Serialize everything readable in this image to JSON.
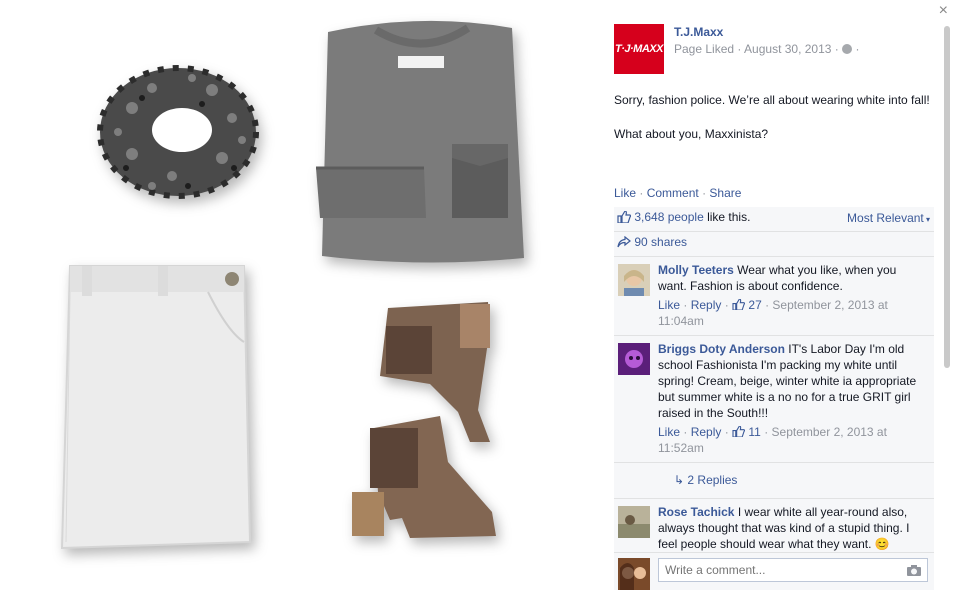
{
  "post": {
    "page_name": "T.J.Maxx",
    "logo_text": "T·J·MAXX",
    "meta": "Page Liked · August 30, 2013 ·",
    "paragraphs": [
      "Sorry, fashion police. We’re all about wearing white into fall!",
      "What about you, Maxxinista?"
    ],
    "actions": {
      "like": "Like",
      "comment": "Comment",
      "share": "Share",
      "sep": "·"
    }
  },
  "ufi": {
    "likes_link": "3,648 people",
    "likes_suffix": " like this.",
    "sort": "Most Relevant",
    "shares": "90 shares"
  },
  "comments": [
    {
      "author": "Molly Teeters",
      "text": "Wear what you like, when you want. Fashion is about confidence.",
      "like": "Like",
      "reply": "Reply",
      "like_count": "27",
      "time": "September 2, 2013 at 11:04am"
    },
    {
      "author": "Briggs Doty Anderson",
      "text": "IT's Labor Day I'm old school Fashionista I'm packing my white until spring! Cream, beige, winter white ia appropriate but summer white is a no no for a true GRIT girl raised in the South!!!",
      "like": "Like",
      "reply": "Reply",
      "like_count": "11",
      "time": "September 2, 2013 at 11:52am"
    },
    {
      "author": "Rose Tachick",
      "text": "I wear white all year-round also, always thought that was kind of a stupid thing. I feel people should wear what they want.",
      "emoji": "😊"
    }
  ],
  "replies_label": "2 Replies",
  "compose": {
    "placeholder": "Write a comment..."
  },
  "close_symbol": "×",
  "colors": {
    "link": "#3b5998",
    "brand_red": "#d6001c",
    "panel_bg": "#f6f7f9"
  },
  "icons": [
    "close-icon",
    "globe-icon",
    "thumbs-up-icon",
    "share-arrow-icon",
    "reply-arrow-icon",
    "camera-icon",
    "caret-down-icon",
    "smiley-emoji"
  ]
}
